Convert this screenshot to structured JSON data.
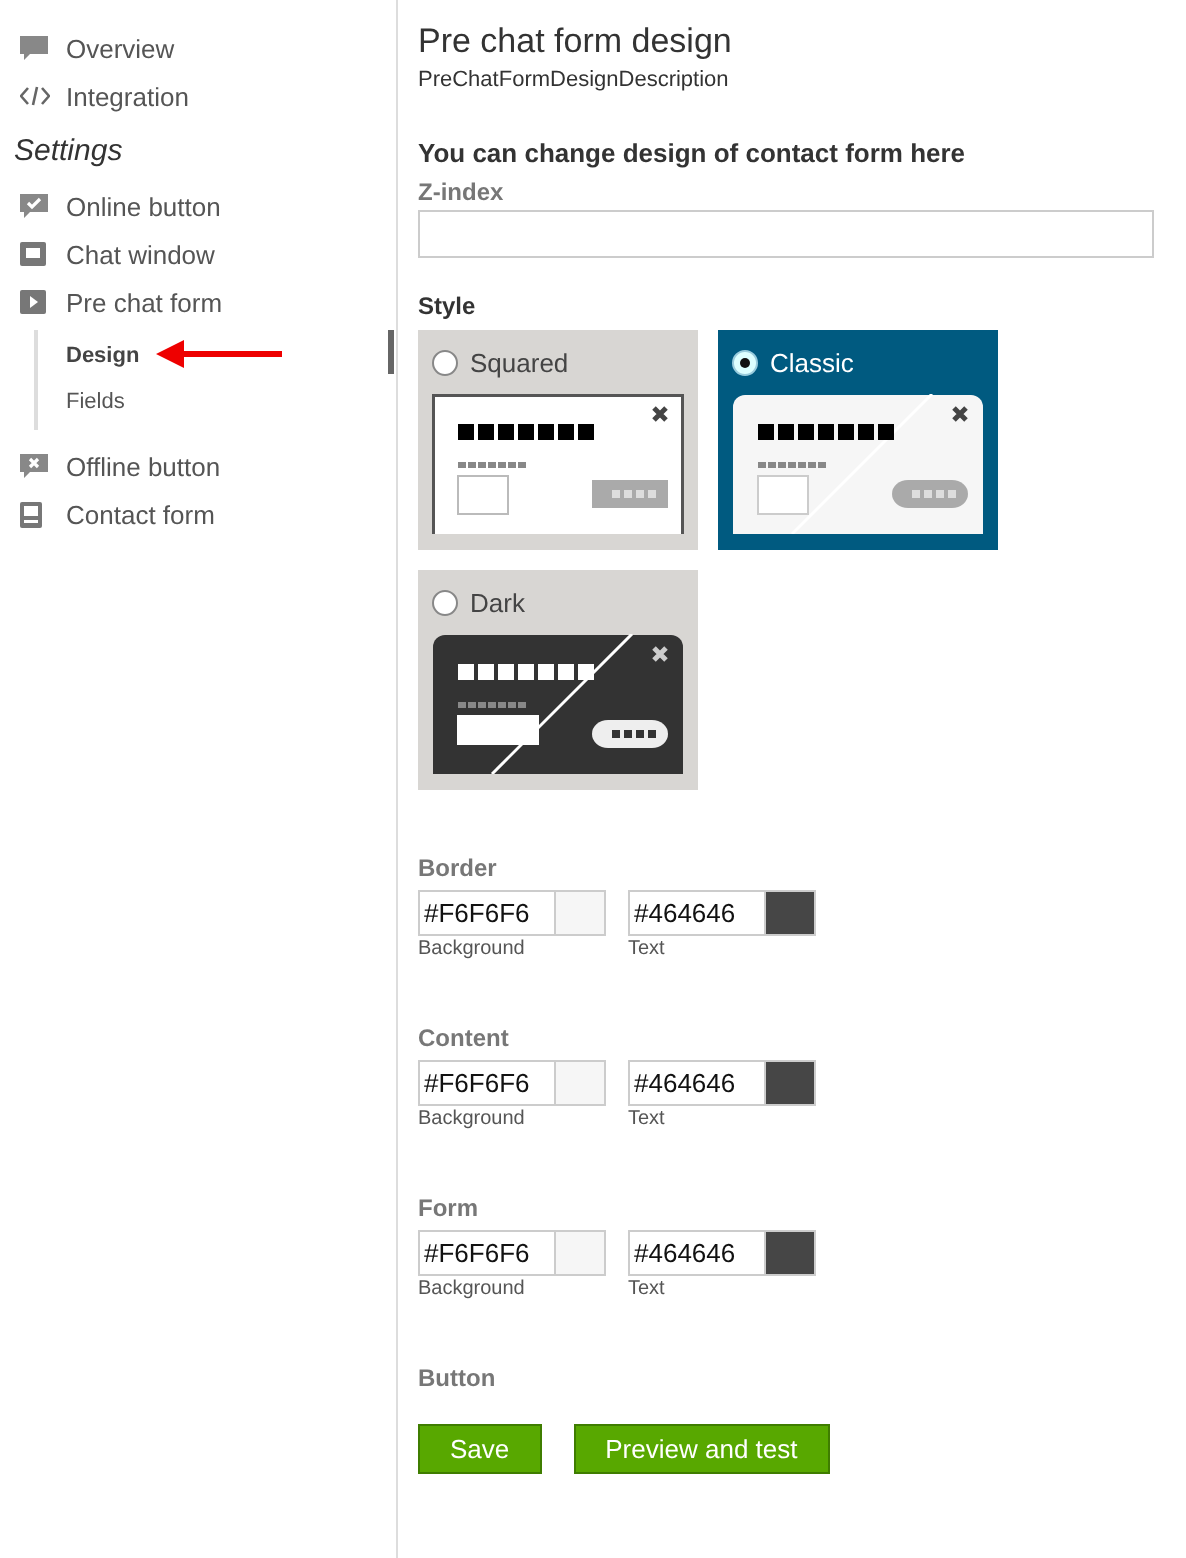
{
  "sidebar": {
    "items": [
      {
        "label": "Overview",
        "kind": "chat"
      },
      {
        "label": "Integration",
        "kind": "code"
      }
    ],
    "section_title": "Settings",
    "settings_items": [
      {
        "label": "Online button",
        "kind": "check"
      },
      {
        "label": "Chat window",
        "kind": "window"
      },
      {
        "label": "Pre chat form",
        "kind": "play",
        "children": [
          {
            "label": "Design",
            "selected": true
          },
          {
            "label": "Fields",
            "selected": false
          }
        ]
      },
      {
        "label": "Offline button",
        "kind": "cross"
      },
      {
        "label": "Contact form",
        "kind": "form"
      }
    ]
  },
  "main": {
    "title": "Pre chat form design",
    "description": "PreChatFormDesignDescription",
    "intro": "You can change design of contact form here",
    "zindex": {
      "label": "Z-index"
    },
    "style": {
      "label": "Style",
      "options": [
        {
          "label": "Squared",
          "kind": "squared",
          "selected": false
        },
        {
          "label": "Classic",
          "kind": "classic",
          "selected": true
        },
        {
          "label": "Dark",
          "kind": "dark",
          "selected": false
        }
      ]
    },
    "color_groups": [
      {
        "title": "Border",
        "fields": [
          {
            "value": "#F6F6F6",
            "caption": "Background",
            "color": "#f6f6f6"
          },
          {
            "value": "#464646",
            "caption": "Text",
            "color": "#464646"
          }
        ]
      },
      {
        "title": "Content",
        "fields": [
          {
            "value": "#F6F6F6",
            "caption": "Background",
            "color": "#f6f6f6"
          },
          {
            "value": "#464646",
            "caption": "Text",
            "color": "#464646"
          }
        ]
      },
      {
        "title": "Form",
        "fields": [
          {
            "value": "#F6F6F6",
            "caption": "Background",
            "color": "#f6f6f6"
          },
          {
            "value": "#464646",
            "caption": "Text",
            "color": "#464646"
          }
        ]
      }
    ],
    "button_section": "Button",
    "buttons": [
      "Save",
      "Preview and test"
    ]
  }
}
